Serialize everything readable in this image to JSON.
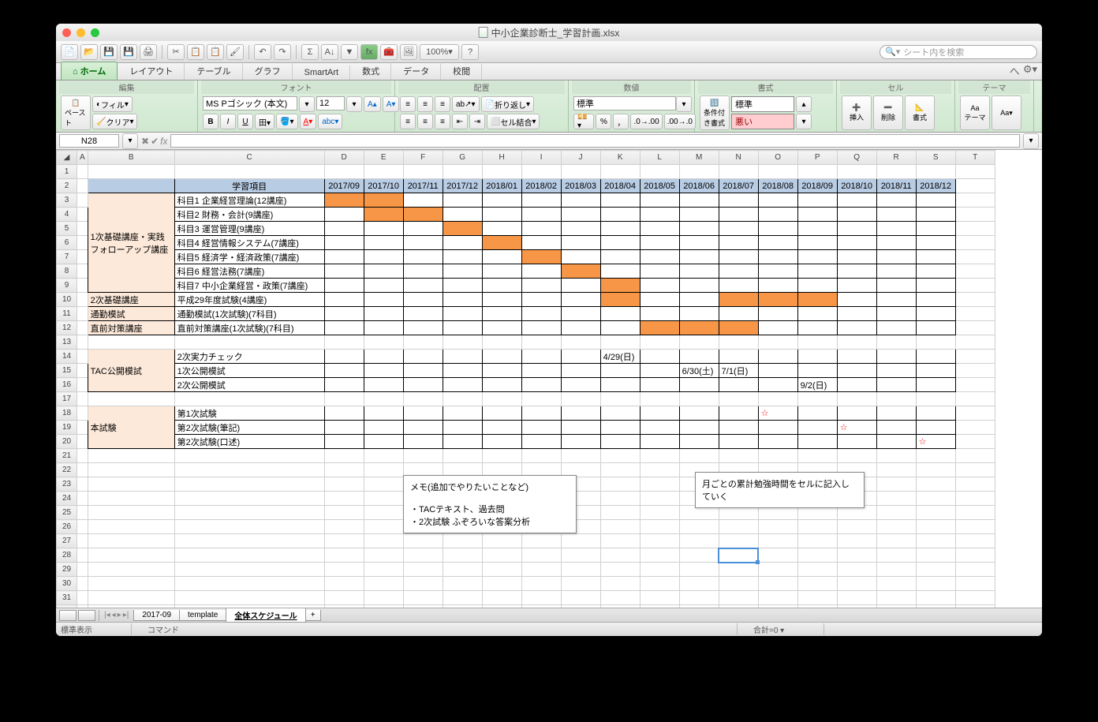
{
  "window": {
    "title": "中小企業診断士_学習計画.xlsx"
  },
  "search": {
    "placeholder": "シート内を検索"
  },
  "tabs": [
    "ホーム",
    "レイアウト",
    "テーブル",
    "グラフ",
    "SmartArt",
    "数式",
    "データ",
    "校閲"
  ],
  "ribbon_groups": {
    "edit": "編集",
    "font": "フォント",
    "align": "配置",
    "number": "数値",
    "format": "書式",
    "cells": "セル",
    "theme": "テーマ"
  },
  "ribbon": {
    "paste": "ペースト",
    "fill": "フィル",
    "clear": "クリア",
    "font_name": "MS Pゴシック (本文)",
    "font_size": "12",
    "wrap": "折り返し",
    "merge": "セル結合",
    "num_format": "標準",
    "cond_format": "条件付き書式",
    "style_normal": "標準",
    "style_bad": "悪い",
    "insert": "挿入",
    "delete": "削除",
    "format": "書式",
    "theme": "テーマ"
  },
  "zoom": "100%",
  "namebox": "N28",
  "columns": [
    "",
    "A",
    "B",
    "C",
    "D",
    "E",
    "F",
    "G",
    "H",
    "I",
    "J",
    "K",
    "L",
    "M",
    "N",
    "O",
    "P",
    "Q",
    "R",
    "S",
    "T"
  ],
  "header_label": "学習項目",
  "months": [
    "2017/09",
    "2017/10",
    "2017/11",
    "2017/12",
    "2018/01",
    "2018/02",
    "2018/03",
    "2018/04",
    "2018/05",
    "2018/06",
    "2018/07",
    "2018/08",
    "2018/09",
    "2018/10",
    "2018/11",
    "2018/12"
  ],
  "sections": {
    "s1": {
      "cat": "1次基礎講座・実践\nフォローアップ講座",
      "items": [
        {
          "label": "科目1 企業経営理論(12講座)",
          "fill": [
            0,
            1
          ]
        },
        {
          "label": "科目2 財務・会計(9講座)",
          "fill": [
            1,
            2
          ]
        },
        {
          "label": "科目3 運営管理(9講座)",
          "fill": [
            3
          ]
        },
        {
          "label": "科目4 経営情報システム(7講座)",
          "fill": [
            4
          ]
        },
        {
          "label": "科目5 経済学・経済政策(7講座)",
          "fill": [
            5
          ]
        },
        {
          "label": "科目6 経営法務(7講座)",
          "fill": [
            6
          ]
        },
        {
          "label": "科目7 中小企業経営・政策(7講座)",
          "fill": [
            7
          ]
        }
      ]
    },
    "s2": {
      "cat": "2次基礎講座",
      "items": [
        {
          "label": "平成29年度試験(4講座)",
          "fill": [
            7,
            10,
            11,
            12
          ]
        }
      ]
    },
    "s3": {
      "cat": "通勤模試",
      "items": [
        {
          "label": "通勤模試(1次試験)(7科目)",
          "fill": []
        }
      ]
    },
    "s4": {
      "cat": "直前対策講座",
      "items": [
        {
          "label": "直前対策講座(1次試験)(7科目)",
          "fill": [
            8,
            9,
            10
          ]
        }
      ]
    },
    "tac": {
      "cat": "TAC公開模試",
      "items": [
        {
          "label": "2次実力チェック",
          "vals": {
            "7": "4/29(日)"
          }
        },
        {
          "label": "1次公開模試",
          "vals": {
            "9": "6/30(土)",
            "10": "7/1(日)"
          }
        },
        {
          "label": "2次公開模試",
          "vals": {
            "12": "9/2(日)"
          }
        }
      ]
    },
    "exam": {
      "cat": "本試験",
      "items": [
        {
          "label": "第1次試験",
          "star": 11
        },
        {
          "label": "第2次試験(筆記)",
          "star": 13
        },
        {
          "label": "第2次試験(口述)",
          "star": 15
        }
      ]
    }
  },
  "notes": {
    "memo_title": "メモ(追加でやりたいことなど)",
    "memo_l1": "・TACテキスト、過去問",
    "memo_l2": "・2次試験 ふぞろいな答案分析",
    "memo2": "月ごとの累計勉強時間をセルに記入していく"
  },
  "sheet_tabs": [
    "2017-09",
    "template",
    "全体スケジュール"
  ],
  "statusbar": {
    "view": "標準表示",
    "cmd": "コマンド",
    "sum": "合計=0"
  }
}
